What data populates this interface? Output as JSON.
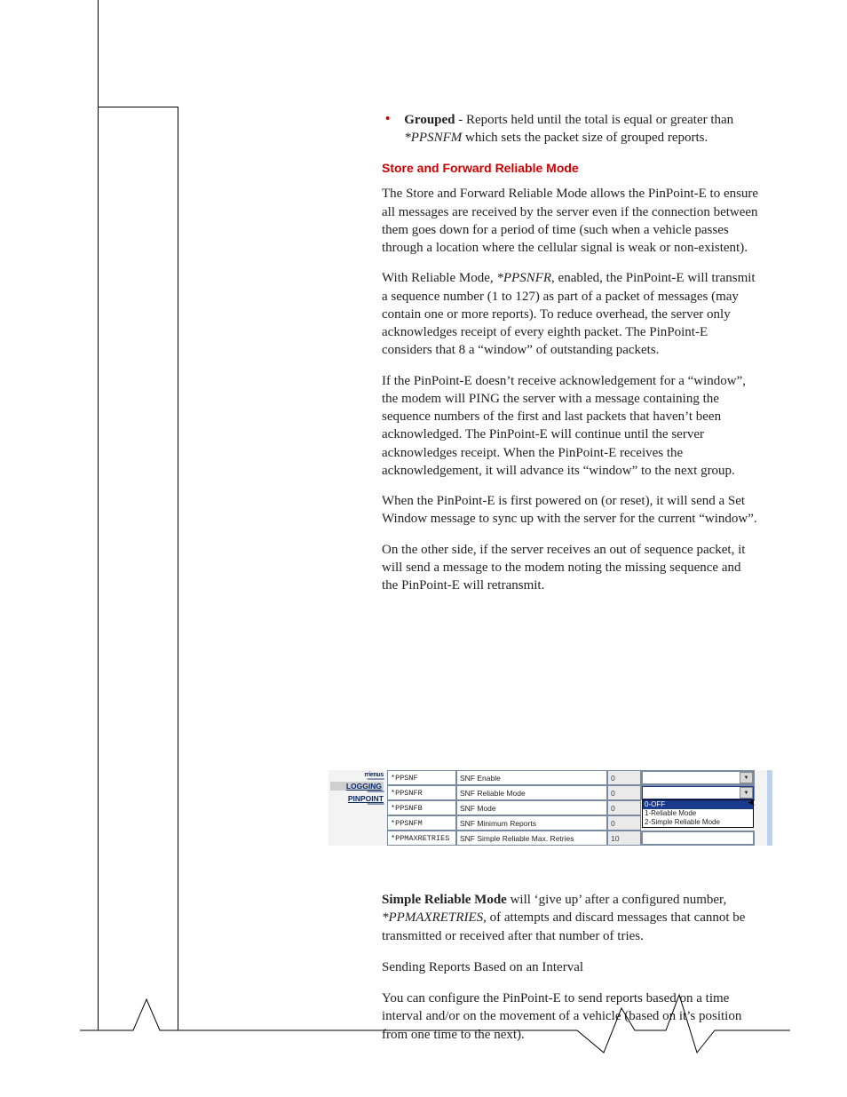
{
  "bullet": {
    "lead": "Grouped",
    "rest1": " - Reports held until the total is equal or greater than ",
    "em": "*PPSNFM",
    "rest2": " which sets the packet size of grouped reports."
  },
  "h1": "Store and Forward Reliable Mode",
  "p1": "The Store and Forward Reliable Mode allows the PinPoint-E to ensure all messages are received by the server even if the connection between them goes down for a period of time (such when a vehicle passes through a location where the cellular signal is weak or non-existent).",
  "p2a": "With Reliable Mode, ",
  "p2em": "*PPSNFR",
  "p2b": ", enabled, the PinPoint-E will transmit a sequence number (1 to 127) as part of a packet of messages (may contain one or more reports). To reduce overhead, the server only acknowledges receipt of every eighth packet. The PinPoint-E considers that 8 a “window” of outstanding packets.",
  "p3": "If the PinPoint-E doesn’t receive acknowledgement for a “window”, the modem will PING the server with a message containing the sequence numbers of the first and last packets that haven’t been acknowledged. The PinPoint-E will continue until the server acknowledges receipt. When the PinPoint-E receives the acknowledgement, it will advance its “window” to the next group.",
  "p4": "When the PinPoint-E is first powered on (or reset), it will send a Set Window message to sync up with the server for the current “window”.",
  "p5": "On the other side, if the server receives an out of sequence packet, it will send a message to the modem noting the missing sequence and the PinPoint-E will retransmit.",
  "shot": {
    "nav": {
      "cut": "rrienus",
      "item1": "LOGGING",
      "item2": "PINPOINT"
    },
    "rows": [
      {
        "code": "*PPSNF",
        "label": "SNF Enable",
        "val": "0",
        "ctrl": "select"
      },
      {
        "code": "*PPSNFR",
        "label": "SNF Reliable Mode",
        "val": "0",
        "ctrl": "select-open"
      },
      {
        "code": "*PPSNFB",
        "label": "SNF Mode",
        "val": "0",
        "ctrl": "none"
      },
      {
        "code": "*PPSNFM",
        "label": "SNF Minimum Reports",
        "val": "0",
        "ctrl": "none"
      },
      {
        "code": "*PPMAXRETRIES",
        "label": "SNF Simple Reliable Max. Retries",
        "val": "10",
        "ctrl": "text"
      }
    ],
    "dropdown": [
      "0-OFF",
      "1-Reliable Mode",
      "2-Simple Reliable Mode"
    ]
  },
  "p6lead": "Simple Reliable Mode",
  "p6a": " will ‘give up’ after a configured number, ",
  "p6em": "*PPMAXRETRIES",
  "p6b": ", of attempts and discard messages that cannot be transmitted or received after that number of tries.",
  "h2": "Sending Reports Based on an Interval",
  "p7": "You can configure the PinPoint-E to send reports based on a time interval and/or on the movement of a vehicle (based on it’s position from one time to the next)."
}
